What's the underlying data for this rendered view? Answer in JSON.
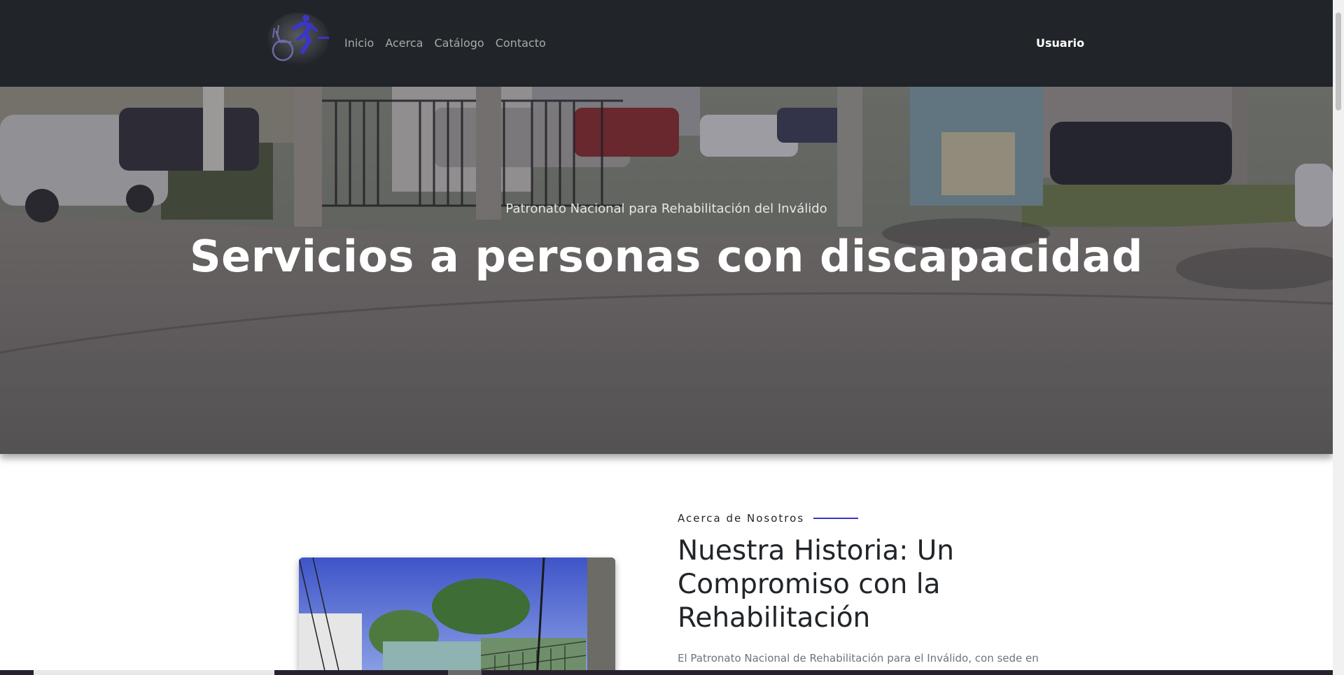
{
  "navbar": {
    "brand_icon": "wheelchair-runner-logo",
    "links": [
      {
        "label": "Inicio"
      },
      {
        "label": "Acerca"
      },
      {
        "label": "Catálogo"
      },
      {
        "label": "Contacto"
      }
    ],
    "user_label": "Usuario"
  },
  "hero": {
    "subtitle": "Patronato Nacional para Rehabilitación del Inválido",
    "title": "Servicios a personas con discapacidad"
  },
  "about": {
    "eyebrow": "Acerca de Nosotros",
    "heading": "Nuestra Historia: Un Compromiso con la Rehabilitación",
    "text": "El Patronato Nacional de Rehabilitación para el Inválido, con sede en"
  },
  "colors": {
    "navbar_bg": "#212529",
    "accent": "#3b35c9",
    "text_dark": "#212529",
    "text_muted": "#6c757d"
  }
}
